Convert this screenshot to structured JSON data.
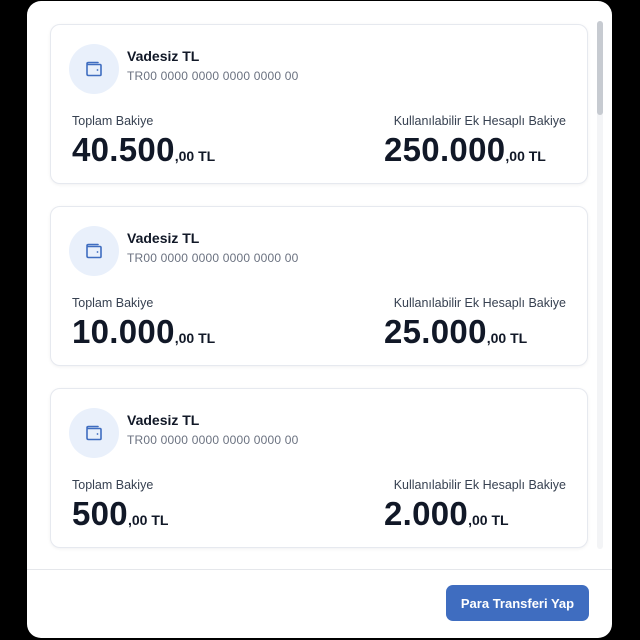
{
  "accounts": [
    {
      "name": "Vadesiz TL",
      "iban": "TR00 0000 0000 0000 0000 00",
      "total_label": "Toplam Bakiye",
      "total_int": "40.500",
      "total_dec": ",00 TL",
      "overdraft_label": "Kullanılabilir Ek Hesaplı Bakiye",
      "overdraft_int": "250.000",
      "overdraft_dec": ",00 TL"
    },
    {
      "name": "Vadesiz TL",
      "iban": "TR00 0000 0000 0000 0000 00",
      "total_label": "Toplam Bakiye",
      "total_int": "10.000",
      "total_dec": ",00 TL",
      "overdraft_label": "Kullanılabilir Ek Hesaplı Bakiye",
      "overdraft_int": "25.000",
      "overdraft_dec": ",00 TL"
    },
    {
      "name": "Vadesiz TL",
      "iban": "TR00 0000 0000 0000 0000 00",
      "total_label": "Toplam Bakiye",
      "total_int": "500",
      "total_dec": ",00 TL",
      "overdraft_label": "Kullanılabilir Ek Hesaplı Bakiye",
      "overdraft_int": "2.000",
      "overdraft_dec": ",00 TL"
    }
  ],
  "icon": "wallet-icon",
  "footer": {
    "transfer_label": "Para Transferi Yap"
  },
  "colors": {
    "accent": "#3f6dc0",
    "icon_bg": "#e9f0fb",
    "icon_stroke": "#3f6dc0",
    "text_primary": "#111827",
    "text_secondary": "#6b7280",
    "card_border": "#e6e9ef"
  }
}
